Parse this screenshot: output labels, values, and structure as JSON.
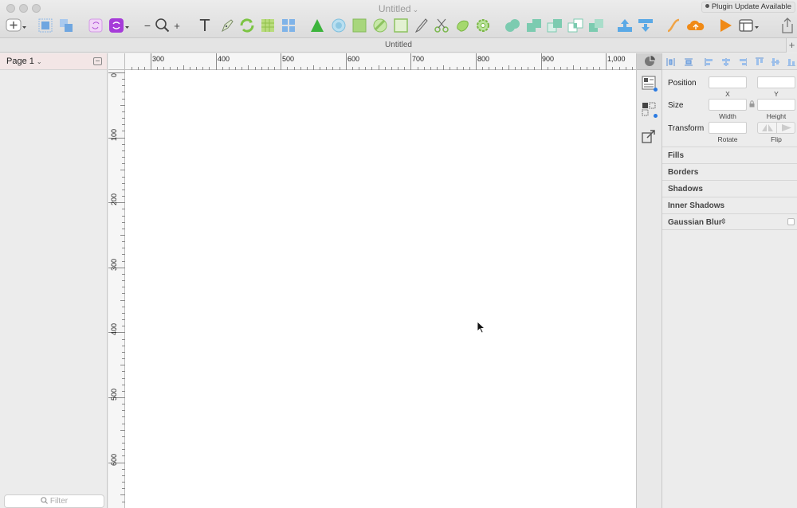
{
  "window": {
    "title": "Untitled",
    "tab_title": "Untitled",
    "plugin_notice": "Plugin Update Available"
  },
  "toolbar": {
    "zoom_out": "−",
    "zoom_in": "+",
    "text_tool": "T",
    "icons": [
      "insert-icon",
      "group-icon",
      "ungroup-icon",
      "symbol-icon",
      "create-symbol-icon",
      "zoom-icon",
      "text-icon",
      "pen-icon",
      "refresh-icon",
      "grid-icon",
      "layout-icon",
      "triangle-icon",
      "circle-icon",
      "square-icon",
      "oval-icon",
      "rectangle-icon",
      "knife-icon",
      "scissors-icon",
      "blob-icon",
      "gear-icon",
      "union-icon",
      "subtract-icon",
      "intersect-icon",
      "difference-icon",
      "flatten-icon",
      "export-icon",
      "import-icon",
      "curve-icon",
      "cloud-icon",
      "play-icon",
      "view-icon",
      "share-icon"
    ]
  },
  "colors": {
    "accent_blue": "#2a7ae2",
    "green": "#5cb83a",
    "orange": "#f08a16",
    "purple": "#a63bd9"
  },
  "layers": {
    "page_label": "Page 1",
    "filter_placeholder": "Filter"
  },
  "ruler": {
    "h_labels": [
      "300",
      "400",
      "500",
      "600",
      "700",
      "800",
      "900",
      "1,000"
    ],
    "v_labels": [
      "0",
      "100",
      "200",
      "300",
      "400",
      "500",
      "600"
    ]
  },
  "inspector": {
    "position_label": "Position",
    "x_label": "X",
    "y_label": "Y",
    "size_label": "Size",
    "width_label": "Width",
    "height_label": "Height",
    "transform_label": "Transform",
    "rotate_label": "Rotate",
    "flip_label": "Flip",
    "sections": [
      "Fills",
      "Borders",
      "Shadows",
      "Inner Shadows",
      "Gaussian Blur"
    ]
  }
}
